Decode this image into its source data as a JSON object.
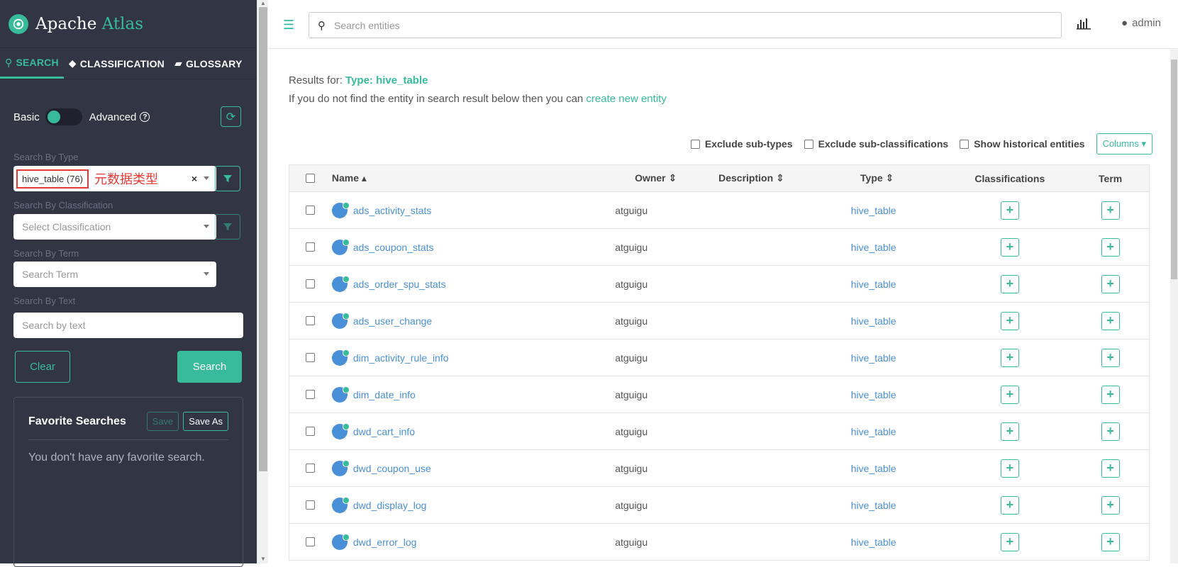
{
  "brand": {
    "name_part1": "Apache ",
    "name_part2": "Atlas"
  },
  "tabs": [
    {
      "icon": "search-icon",
      "label": "SEARCH"
    },
    {
      "icon": "tag-icon",
      "label": "CLASSIFICATION"
    },
    {
      "icon": "folder-icon",
      "label": "GLOSSARY"
    }
  ],
  "search_panel": {
    "basic_label": "Basic",
    "advanced_label": "Advanced",
    "by_type_label": "Search By Type",
    "type_value": "hive_table (76)",
    "type_annotation": "元数据类型",
    "clear_symbol": "×",
    "by_classification_label": "Search By Classification",
    "classification_placeholder": "Select Classification",
    "by_term_label": "Search By Term",
    "term_placeholder": "Search Term",
    "by_text_label": "Search By Text",
    "text_placeholder": "Search by text",
    "clear_button": "Clear",
    "search_button": "Search"
  },
  "favorites": {
    "title": "Favorite Searches",
    "save": "Save",
    "save_as": "Save As",
    "empty": "You don't have any favorite search."
  },
  "topbar": {
    "search_placeholder": "Search entities",
    "user": "admin"
  },
  "results": {
    "prefix": "Results for: ",
    "type_text": "Type: hive_table",
    "hint_prefix": "If you do not find the entity in search result below then you can ",
    "hint_link": "create new entity"
  },
  "options": {
    "exclude_subtypes": "Exclude sub-types",
    "exclude_subclassifications": "Exclude sub-classifications",
    "show_historical": "Show historical entities",
    "columns": "Columns ▾"
  },
  "table": {
    "headers": {
      "name": "Name ▴",
      "owner": "Owner ⇕",
      "description": "Description ⇕",
      "type": "Type ⇕",
      "classifications": "Classifications",
      "term": "Term"
    },
    "rows": [
      {
        "name": "ads_activity_stats",
        "owner": "atguigu",
        "type": "hive_table"
      },
      {
        "name": "ads_coupon_stats",
        "owner": "atguigu",
        "type": "hive_table"
      },
      {
        "name": "ads_order_spu_stats",
        "owner": "atguigu",
        "type": "hive_table"
      },
      {
        "name": "ads_user_change",
        "owner": "atguigu",
        "type": "hive_table"
      },
      {
        "name": "dim_activity_rule_info",
        "owner": "atguigu",
        "type": "hive_table"
      },
      {
        "name": "dim_date_info",
        "owner": "atguigu",
        "type": "hive_table"
      },
      {
        "name": "dwd_cart_info",
        "owner": "atguigu",
        "type": "hive_table"
      },
      {
        "name": "dwd_coupon_use",
        "owner": "atguigu",
        "type": "hive_table"
      },
      {
        "name": "dwd_display_log",
        "owner": "atguigu",
        "type": "hive_table"
      },
      {
        "name": "dwd_error_log",
        "owner": "atguigu",
        "type": "hive_table"
      }
    ]
  },
  "colors": {
    "accent": "#37bb9b",
    "sidebar_bg": "#323544",
    "link": "#4a90d9",
    "annotation": "#e53935"
  }
}
